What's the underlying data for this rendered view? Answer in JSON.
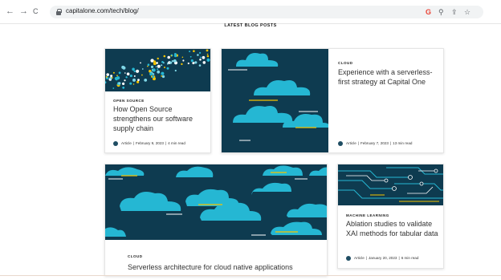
{
  "browser": {
    "back_icon": "←",
    "forward_icon": "→",
    "reload_icon": "C",
    "url": "capitalone.com/tech/blog/",
    "google_icon": "G",
    "zoom_icon": "⚲",
    "share_icon": "⇪",
    "bookmark_icon": "☆"
  },
  "page": {
    "section_title": "LATEST BLOG POSTS"
  },
  "posts": [
    {
      "category": "OPEN SOURCE",
      "title": "How Open Source strengthens our software supply chain",
      "type": "Article",
      "date": "February 9, 2023",
      "read_time": "4 min read"
    },
    {
      "category": "CLOUD",
      "title": "Experience with a serverless-first strategy at Capital One",
      "type": "Article",
      "date": "February 7, 2023",
      "read_time": "13 min read"
    },
    {
      "category": "CLOUD",
      "title": "Serverless architecture for cloud native applications"
    },
    {
      "category": "MACHINE LEARNING",
      "title": "Ablation studies to validate XAI methods for tabular data",
      "type": "Article",
      "date": "January 20, 2023",
      "read_time": "6 min read"
    }
  ],
  "colors": {
    "image_bg": "#0e3b50",
    "cloud": "#25b7d3",
    "accent": "#f5c400"
  }
}
